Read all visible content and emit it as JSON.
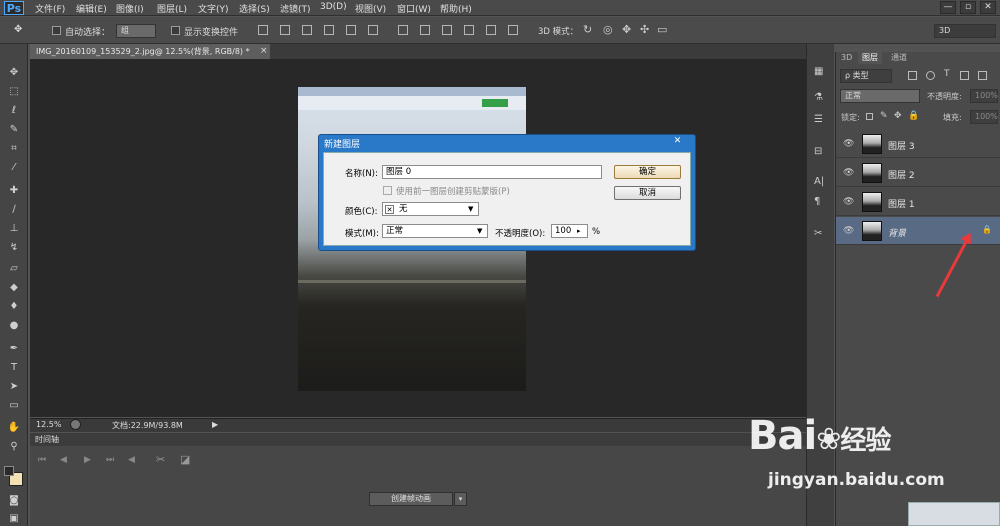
{
  "app": {
    "logo": "Ps"
  },
  "menu": [
    "文件(F)",
    "编辑(E)",
    "图像(I)",
    "图层(L)",
    "文字(Y)",
    "选择(S)",
    "滤镜(T)",
    "3D(D)",
    "视图(V)",
    "窗口(W)",
    "帮助(H)"
  ],
  "window_controls": [
    "—",
    "▫",
    "✕"
  ],
  "options": {
    "auto_select_label": "自动选择：",
    "auto_select_value": "组",
    "show_transform_label": "显示变换控件",
    "mode_3d_label": "3D 模式：",
    "workspace": "3D"
  },
  "document": {
    "tab_title": "IMG_20160109_153529_2.jpg@ 12.5%(背景, RGB/8) *",
    "tab_close": "×",
    "zoom": "12.5%",
    "doc_info": "文档:22.9M/93.8M"
  },
  "timeline": {
    "title": "时间轴",
    "create_button": "创建帧动画",
    "dropdown": "▾"
  },
  "panels": {
    "tabs": [
      "3D",
      "图层",
      "通道"
    ],
    "filter": "ρ 类型",
    "blend_mode": "正常",
    "opacity_label": "不透明度:",
    "opacity_value": "100%",
    "lock_label": "锁定:",
    "fill_label": "填充:",
    "fill_value": "100%"
  },
  "layers": [
    {
      "name": "图层 3"
    },
    {
      "name": "图层 2"
    },
    {
      "name": "图层 1"
    },
    {
      "name": "背景"
    }
  ],
  "dialog": {
    "title": "新建图层",
    "close": "✕",
    "name_label": "名称(N):",
    "name_value": "图层 0",
    "clip_label": "使用前一图层创建剪贴蒙版(P)",
    "color_label": "颜色(C):",
    "color_value": "无",
    "mode_label": "模式(M):",
    "mode_value": "正常",
    "opacity_label": "不透明度(O):",
    "opacity_value": "100",
    "percent": "%",
    "ok": "确定",
    "cancel": "取消"
  },
  "watermark": {
    "brand": "Bai",
    "brand2": "经验",
    "url": "jingyan.baidu.com"
  },
  "colors": {
    "dialog_title_bar": "#2a78c8",
    "arrow": "#e83a3a",
    "selected_layer": "#596a85"
  }
}
